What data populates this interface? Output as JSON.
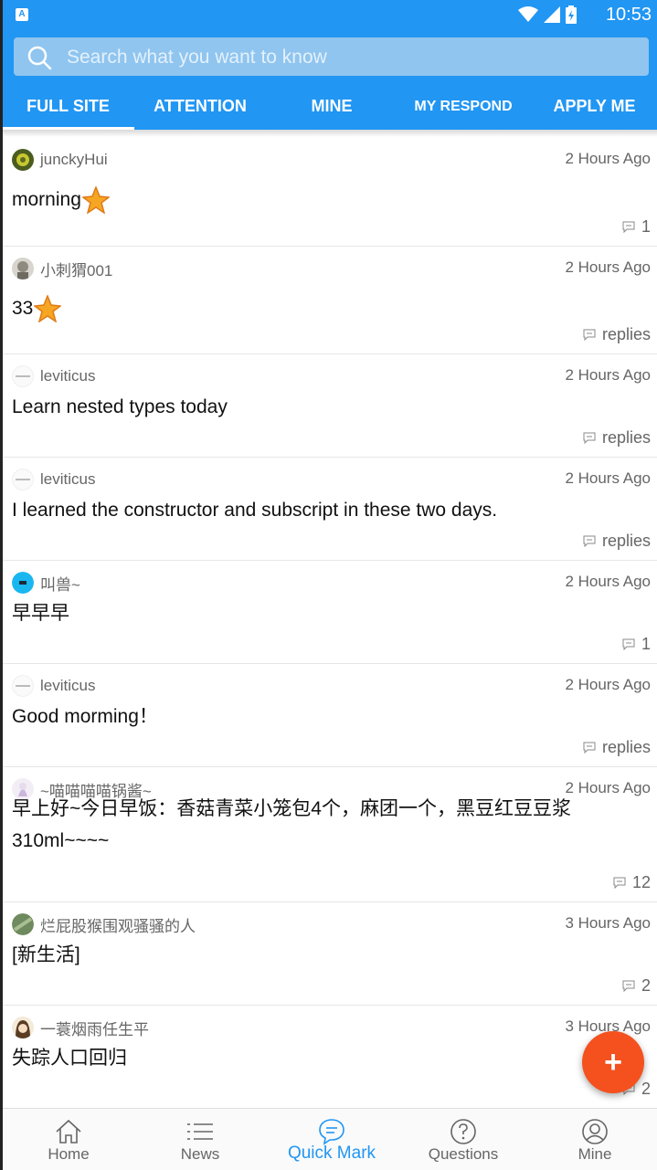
{
  "status_bar": {
    "time": "10:53",
    "app_letter": "A"
  },
  "search": {
    "placeholder": "Search what you want to know"
  },
  "tabs": [
    {
      "label": "FULL SITE",
      "active": true
    },
    {
      "label": "ATTENTION",
      "active": false
    },
    {
      "label": "MINE",
      "active": false
    },
    {
      "label": "MY RESPOND",
      "active": false
    },
    {
      "label": "APPLY ME",
      "active": false
    }
  ],
  "posts": [
    {
      "user": "junckyHui",
      "time": "2 Hours Ago",
      "content": "morning",
      "emoji": "star",
      "reply": "1"
    },
    {
      "user": "小刺猬001",
      "time": "2 Hours Ago",
      "content": "33",
      "emoji": "star",
      "reply": "replies"
    },
    {
      "user": "leviticus",
      "time": "2 Hours Ago",
      "content": "Learn nested types today",
      "reply": "replies"
    },
    {
      "user": "leviticus",
      "time": "2 Hours Ago",
      "content": "I learned the constructor and subscript in these two days.",
      "reply": "replies"
    },
    {
      "user": "叫兽~",
      "time": "2 Hours Ago",
      "content": "早早早",
      "reply": "1"
    },
    {
      "user": "leviticus",
      "time": "2 Hours Ago",
      "content": "Good morming！",
      "reply": "replies"
    },
    {
      "user": "~喵喵喵喵锅酱~",
      "time": "2 Hours Ago",
      "content": "早上好~今日早饭：香菇青菜小笼包4个，麻团一个，黑豆红豆豆浆310ml~~~~",
      "reply": "12"
    },
    {
      "user": "烂屁股猴围观骚骚的人",
      "time": "3 Hours Ago",
      "content": "[新生活]",
      "reply": "2"
    },
    {
      "user": "一蓑烟雨任生平",
      "time": "3 Hours Ago",
      "content": "失踪人口回归",
      "reply": "2"
    }
  ],
  "fab": {
    "label": "+"
  },
  "bottom_nav": [
    {
      "label": "Home",
      "icon": "home-icon",
      "active": false
    },
    {
      "label": "News",
      "icon": "list-icon",
      "active": false
    },
    {
      "label": "Quick Mark",
      "icon": "chat-bubble-icon",
      "active": true
    },
    {
      "label": "Questions",
      "icon": "question-icon",
      "active": false
    },
    {
      "label": "Mine",
      "icon": "person-icon",
      "active": false
    }
  ],
  "colors": {
    "primary": "#2196f3",
    "fab": "#f4511e",
    "text": "#111111",
    "muted": "#666666"
  }
}
